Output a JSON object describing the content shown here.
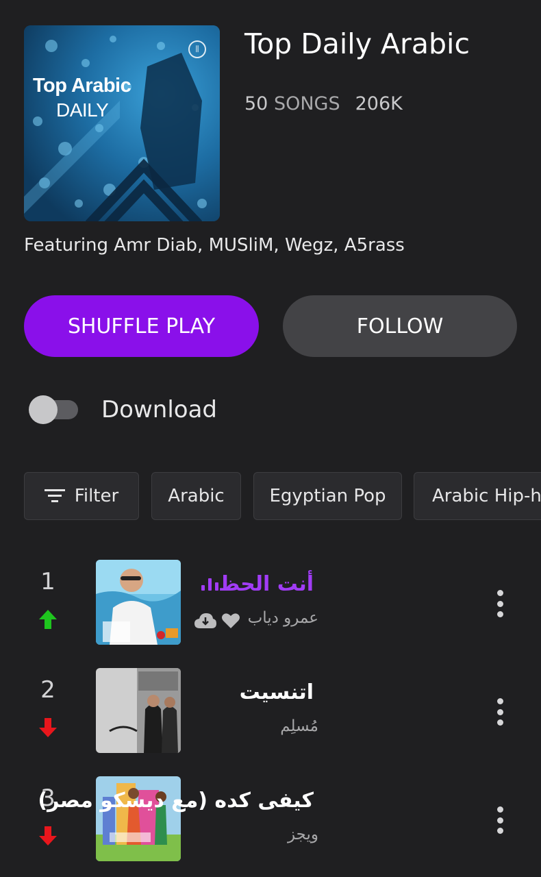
{
  "playlist": {
    "cover_title_line1": "Top Arabic",
    "cover_title_line2": "DAILY",
    "title": "Top Daily Arabic",
    "song_count": "50",
    "song_count_unit": "SONGS",
    "followers": "206K",
    "featuring": "Featuring Amr Diab, MUSliM, Wegz, A5rass"
  },
  "actions": {
    "shuffle_label": "SHUFFLE PLAY",
    "follow_label": "FOLLOW",
    "download_label": "Download",
    "download_enabled": false
  },
  "filters": {
    "filter_label": "Filter",
    "chips": [
      "Arabic",
      "Egyptian Pop",
      "Arabic Hip-h"
    ]
  },
  "tracks": [
    {
      "rank": "1",
      "title": "أنت الحظ",
      "artist": "عمرو دياب",
      "trend": "up",
      "playing": true,
      "icons": [
        "download-cloud-icon",
        "heart-icon"
      ]
    },
    {
      "rank": "2",
      "title": "اتنسيت",
      "artist": "مُسلِم",
      "trend": "down",
      "playing": false
    },
    {
      "rank": "3",
      "title": "كيفى كده (مع ديسكو مصر)",
      "artist": "ويجز",
      "trend": "down",
      "playing": false
    }
  ],
  "colors": {
    "background": "#1f1f21",
    "accent": "#8a10ea",
    "playing_text": "#a13cf6",
    "trend_up": "#1ec51e",
    "trend_down": "#e8161c"
  }
}
